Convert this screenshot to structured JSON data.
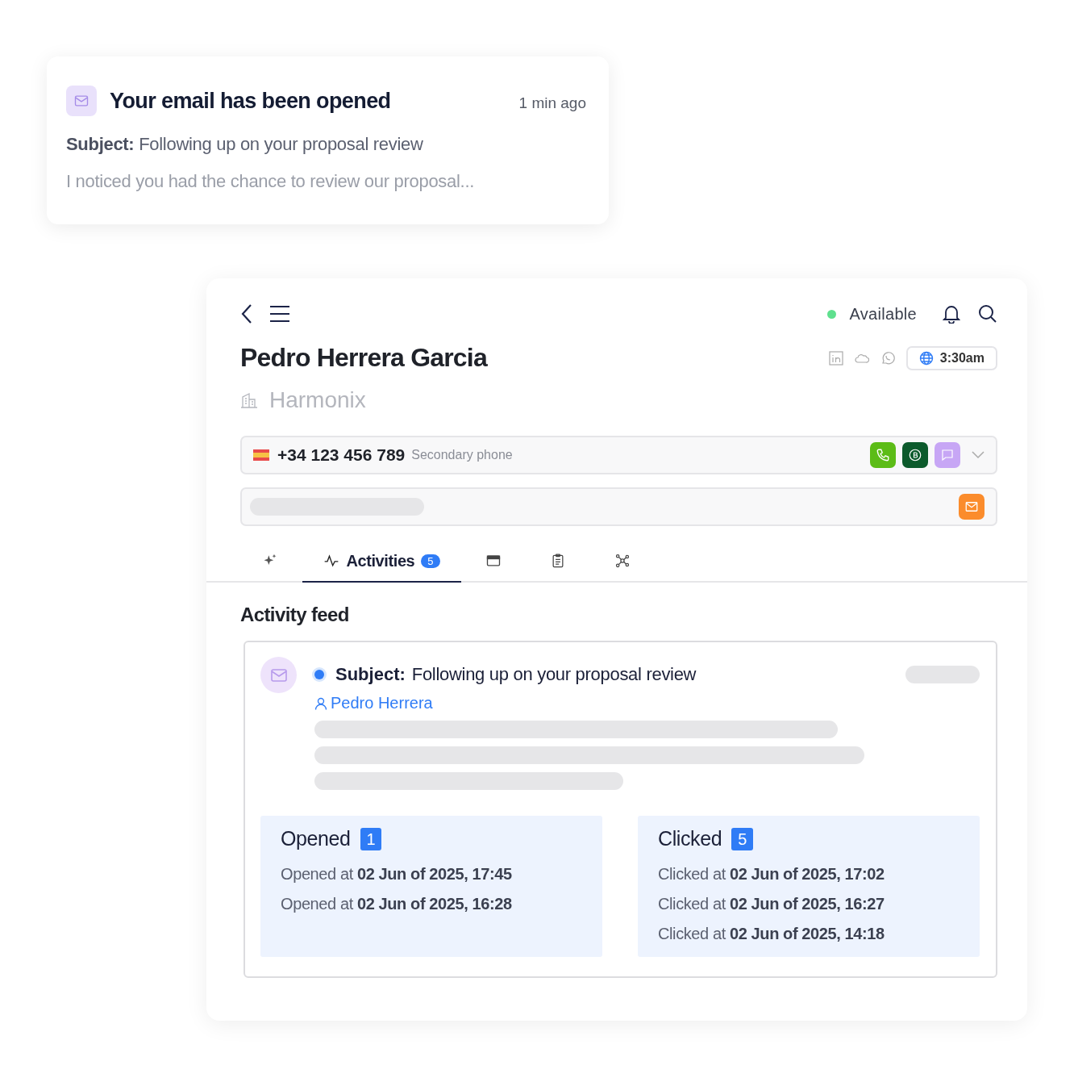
{
  "notification": {
    "title": "Your email has been opened",
    "time": "1 min ago",
    "subject": "**Subject:** Following up on your proposal review",
    "preview": "I noticed you had the chance to review our proposal..."
  },
  "contact": {
    "status": {
      "label": "Available",
      "online": true
    },
    "name": "Pedro Herrera Garcia",
    "company": "Harmonix",
    "local_time": "3:30am",
    "phone": {
      "number": "+34 123 456 789",
      "label": "Secondary phone"
    },
    "tabs": [
      {
        "kind": "ai",
        "selected": false
      },
      {
        "kind": "activities",
        "label": "Activities",
        "badge": "5",
        "selected": true
      },
      {
        "kind": "card",
        "selected": false
      },
      {
        "kind": "notes",
        "selected": false
      },
      {
        "kind": "graph",
        "selected": false
      }
    ]
  },
  "feed": {
    "title": "Activity feed",
    "item": {
      "unread": true,
      "subject_label": "Subject:",
      "subject": "Following up on your proposal review",
      "person": "Pedro Herrera",
      "stats": [
        {
          "title": "Opened",
          "count": "1",
          "lines": [
            "Opened at **02 Jun of 2025, 17:45**",
            "Opened at **02 Jun of 2025, 16:28**"
          ]
        },
        {
          "title": "Clicked",
          "count": "5",
          "lines": [
            "Clicked at **02 Jun of 2025, 17:02**",
            "Clicked at **02 Jun of 2025, 16:27**",
            "Clicked at **02 Jun of 2025, 14:18**"
          ]
        }
      ]
    }
  }
}
